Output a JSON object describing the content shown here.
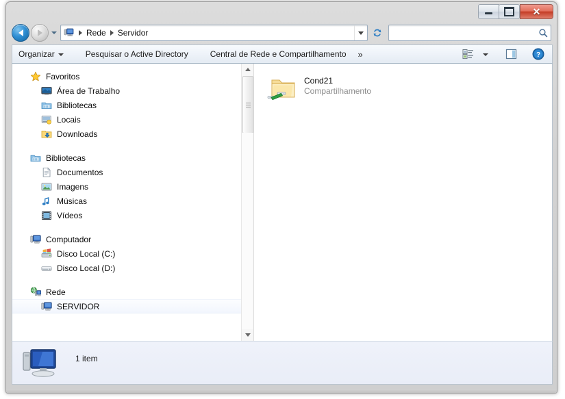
{
  "window": {
    "controls": {
      "minimize_label": "–",
      "maximize_label": "",
      "close_label": "✕"
    }
  },
  "navbar": {
    "back_tooltip": "Voltar",
    "forward_tooltip": "Avançar",
    "breadcrumb": [
      {
        "label": "Rede"
      },
      {
        "label": "Servidor"
      }
    ],
    "refresh_tooltip": "Atualizar",
    "search": {
      "value": "",
      "placeholder": ""
    }
  },
  "toolbar": {
    "organize_label": "Organizar",
    "search_ad_label": "Pesquisar o Active Directory",
    "network_center_label": "Central de Rede e Compartilhamento",
    "overflow_label": "»",
    "view_tooltip": "Alterar a exibição",
    "preview_tooltip": "Mostrar o painel de visualização",
    "help_tooltip": "Obter ajuda"
  },
  "sidebar": {
    "groups": [
      {
        "header": {
          "label": "Favoritos",
          "icon": "star-icon"
        },
        "items": [
          {
            "label": "Área de Trabalho",
            "icon": "desktop-icon"
          },
          {
            "label": "Bibliotecas",
            "icon": "libraries-icon"
          },
          {
            "label": "Locais",
            "icon": "places-icon"
          },
          {
            "label": "Downloads",
            "icon": "downloads-icon"
          }
        ]
      },
      {
        "header": {
          "label": "Bibliotecas",
          "icon": "libraries-icon"
        },
        "items": [
          {
            "label": "Documentos",
            "icon": "documents-icon"
          },
          {
            "label": "Imagens",
            "icon": "pictures-icon"
          },
          {
            "label": "Músicas",
            "icon": "music-icon"
          },
          {
            "label": "Vídeos",
            "icon": "videos-icon"
          }
        ]
      },
      {
        "header": {
          "label": "Computador",
          "icon": "computer-icon"
        },
        "items": [
          {
            "label": "Disco Local (C:)",
            "icon": "system-drive-icon"
          },
          {
            "label": "Disco Local (D:)",
            "icon": "drive-icon"
          }
        ]
      },
      {
        "header": {
          "label": "Rede",
          "icon": "network-icon"
        },
        "items": [
          {
            "label": "SERVIDOR",
            "icon": "computer-icon",
            "hover": true
          }
        ]
      }
    ]
  },
  "content": {
    "items": [
      {
        "name": "Cond21",
        "subtitle": "Compartilhamento",
        "icon": "shared-folder-icon"
      }
    ]
  },
  "statusbar": {
    "icon": "computer-large-icon",
    "text": "1 item"
  },
  "colors": {
    "accent_blue": "#2f8fd4",
    "close_red": "#c43d26",
    "folder_yellow": "#fcdf8a",
    "share_green": "#2f9e44",
    "status_bg": "#eef1f8"
  }
}
